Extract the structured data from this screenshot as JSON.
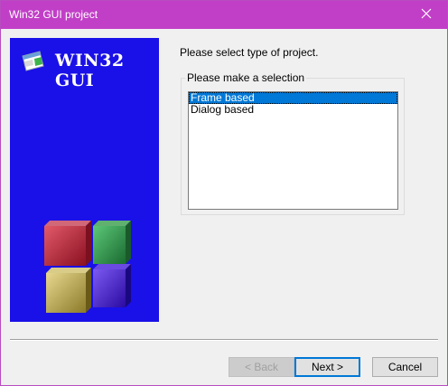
{
  "window": {
    "title": "Win32 GUI project",
    "accent_color": "#c13fc7",
    "close_icon": "close-icon"
  },
  "side_panel": {
    "background_color": "#1a10e8",
    "logo_icon": "application-window-icon",
    "logo_text": "WIN32 GUI",
    "cube_colors": [
      "#c8243a",
      "#2a9d48",
      "#c9b84a",
      "#4a20d8"
    ]
  },
  "main": {
    "prompt": "Please select type of project.",
    "group_label": "Please make a selection",
    "options": [
      {
        "label": "Frame based",
        "selected": true
      },
      {
        "label": "Dialog based",
        "selected": false
      }
    ]
  },
  "buttons": {
    "back": "< Back",
    "next": "Next >",
    "cancel": "Cancel"
  }
}
